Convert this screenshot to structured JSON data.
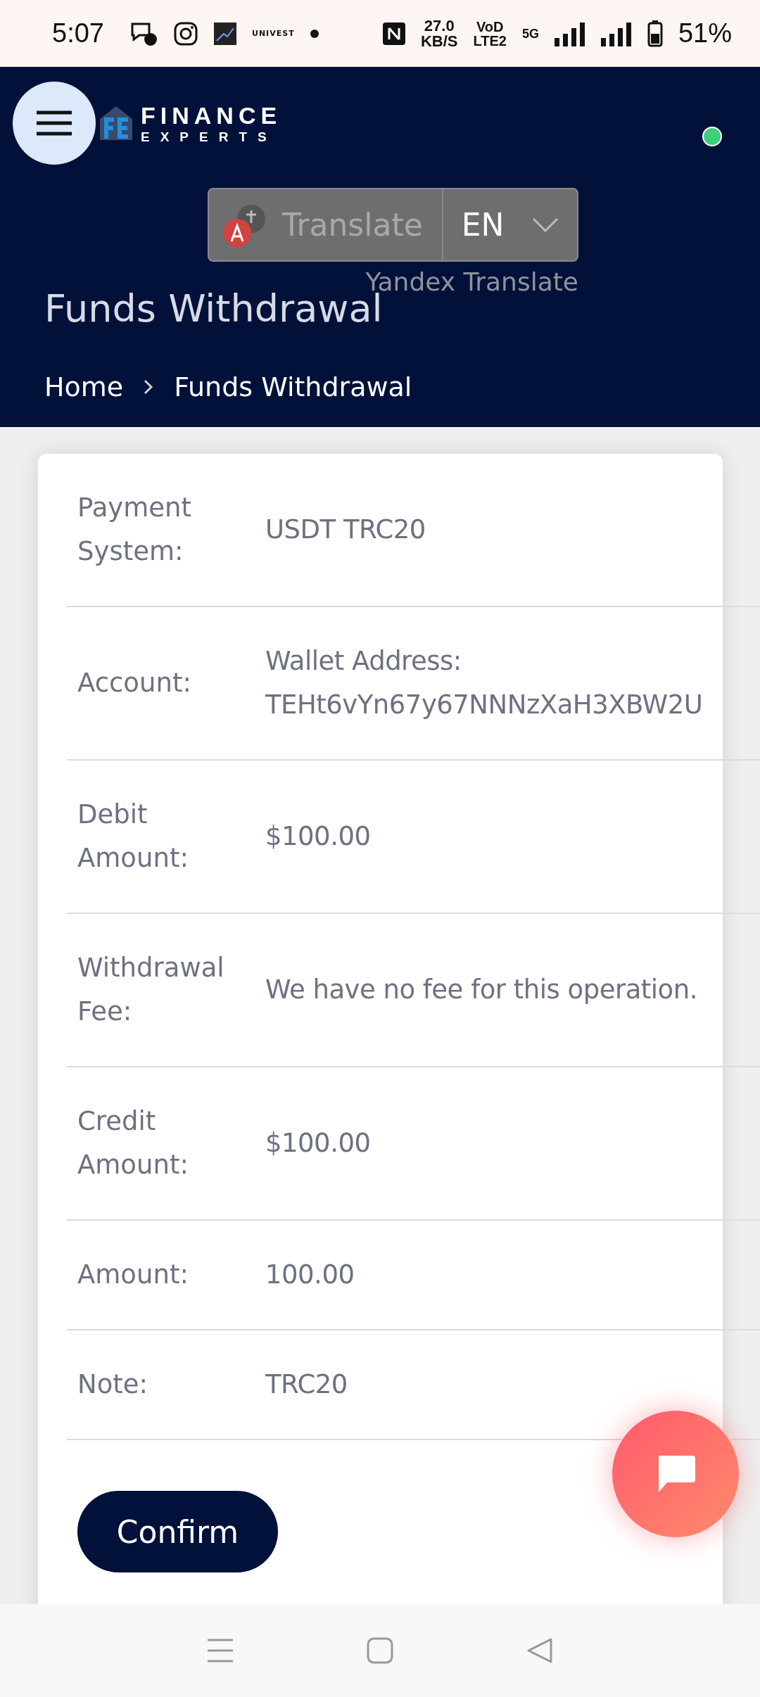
{
  "status_bar": {
    "time": "5:07",
    "notification_texts": [
      "UNIVEST"
    ],
    "speed": "27.0",
    "speed_unit": "KB/S",
    "volte": "VoD",
    "lte": "LTE2",
    "network": "5G",
    "battery": "51%"
  },
  "header": {
    "brand_top": "FINANCE",
    "brand_bottom": "EXPERTS",
    "online": true,
    "translate": {
      "label": "Translate",
      "language": "EN",
      "caption": "Yandex Translate"
    },
    "title": "Funds Withdrawal",
    "breadcrumb": [
      {
        "label": "Home"
      },
      {
        "label": "Funds Withdrawal"
      }
    ]
  },
  "details": [
    {
      "label": "Payment System:",
      "lines": [
        "USDT TRC20"
      ]
    },
    {
      "label": "Account:",
      "lines": [
        "Wallet Address:",
        "TEHt6vYn67y67NNNzXaH3XBW2U"
      ]
    },
    {
      "label": "Debit Amount:",
      "lines": [
        "$100.00"
      ]
    },
    {
      "label": "Withdrawal Fee:",
      "lines": [
        "We have no fee for this operation."
      ]
    },
    {
      "label": "Credit Amount:",
      "lines": [
        "$100.00"
      ]
    },
    {
      "label": "Amount:",
      "lines": [
        "100.00"
      ]
    },
    {
      "label": "Note:",
      "lines": [
        "TRC20"
      ]
    }
  ],
  "confirm_button": "Confirm"
}
